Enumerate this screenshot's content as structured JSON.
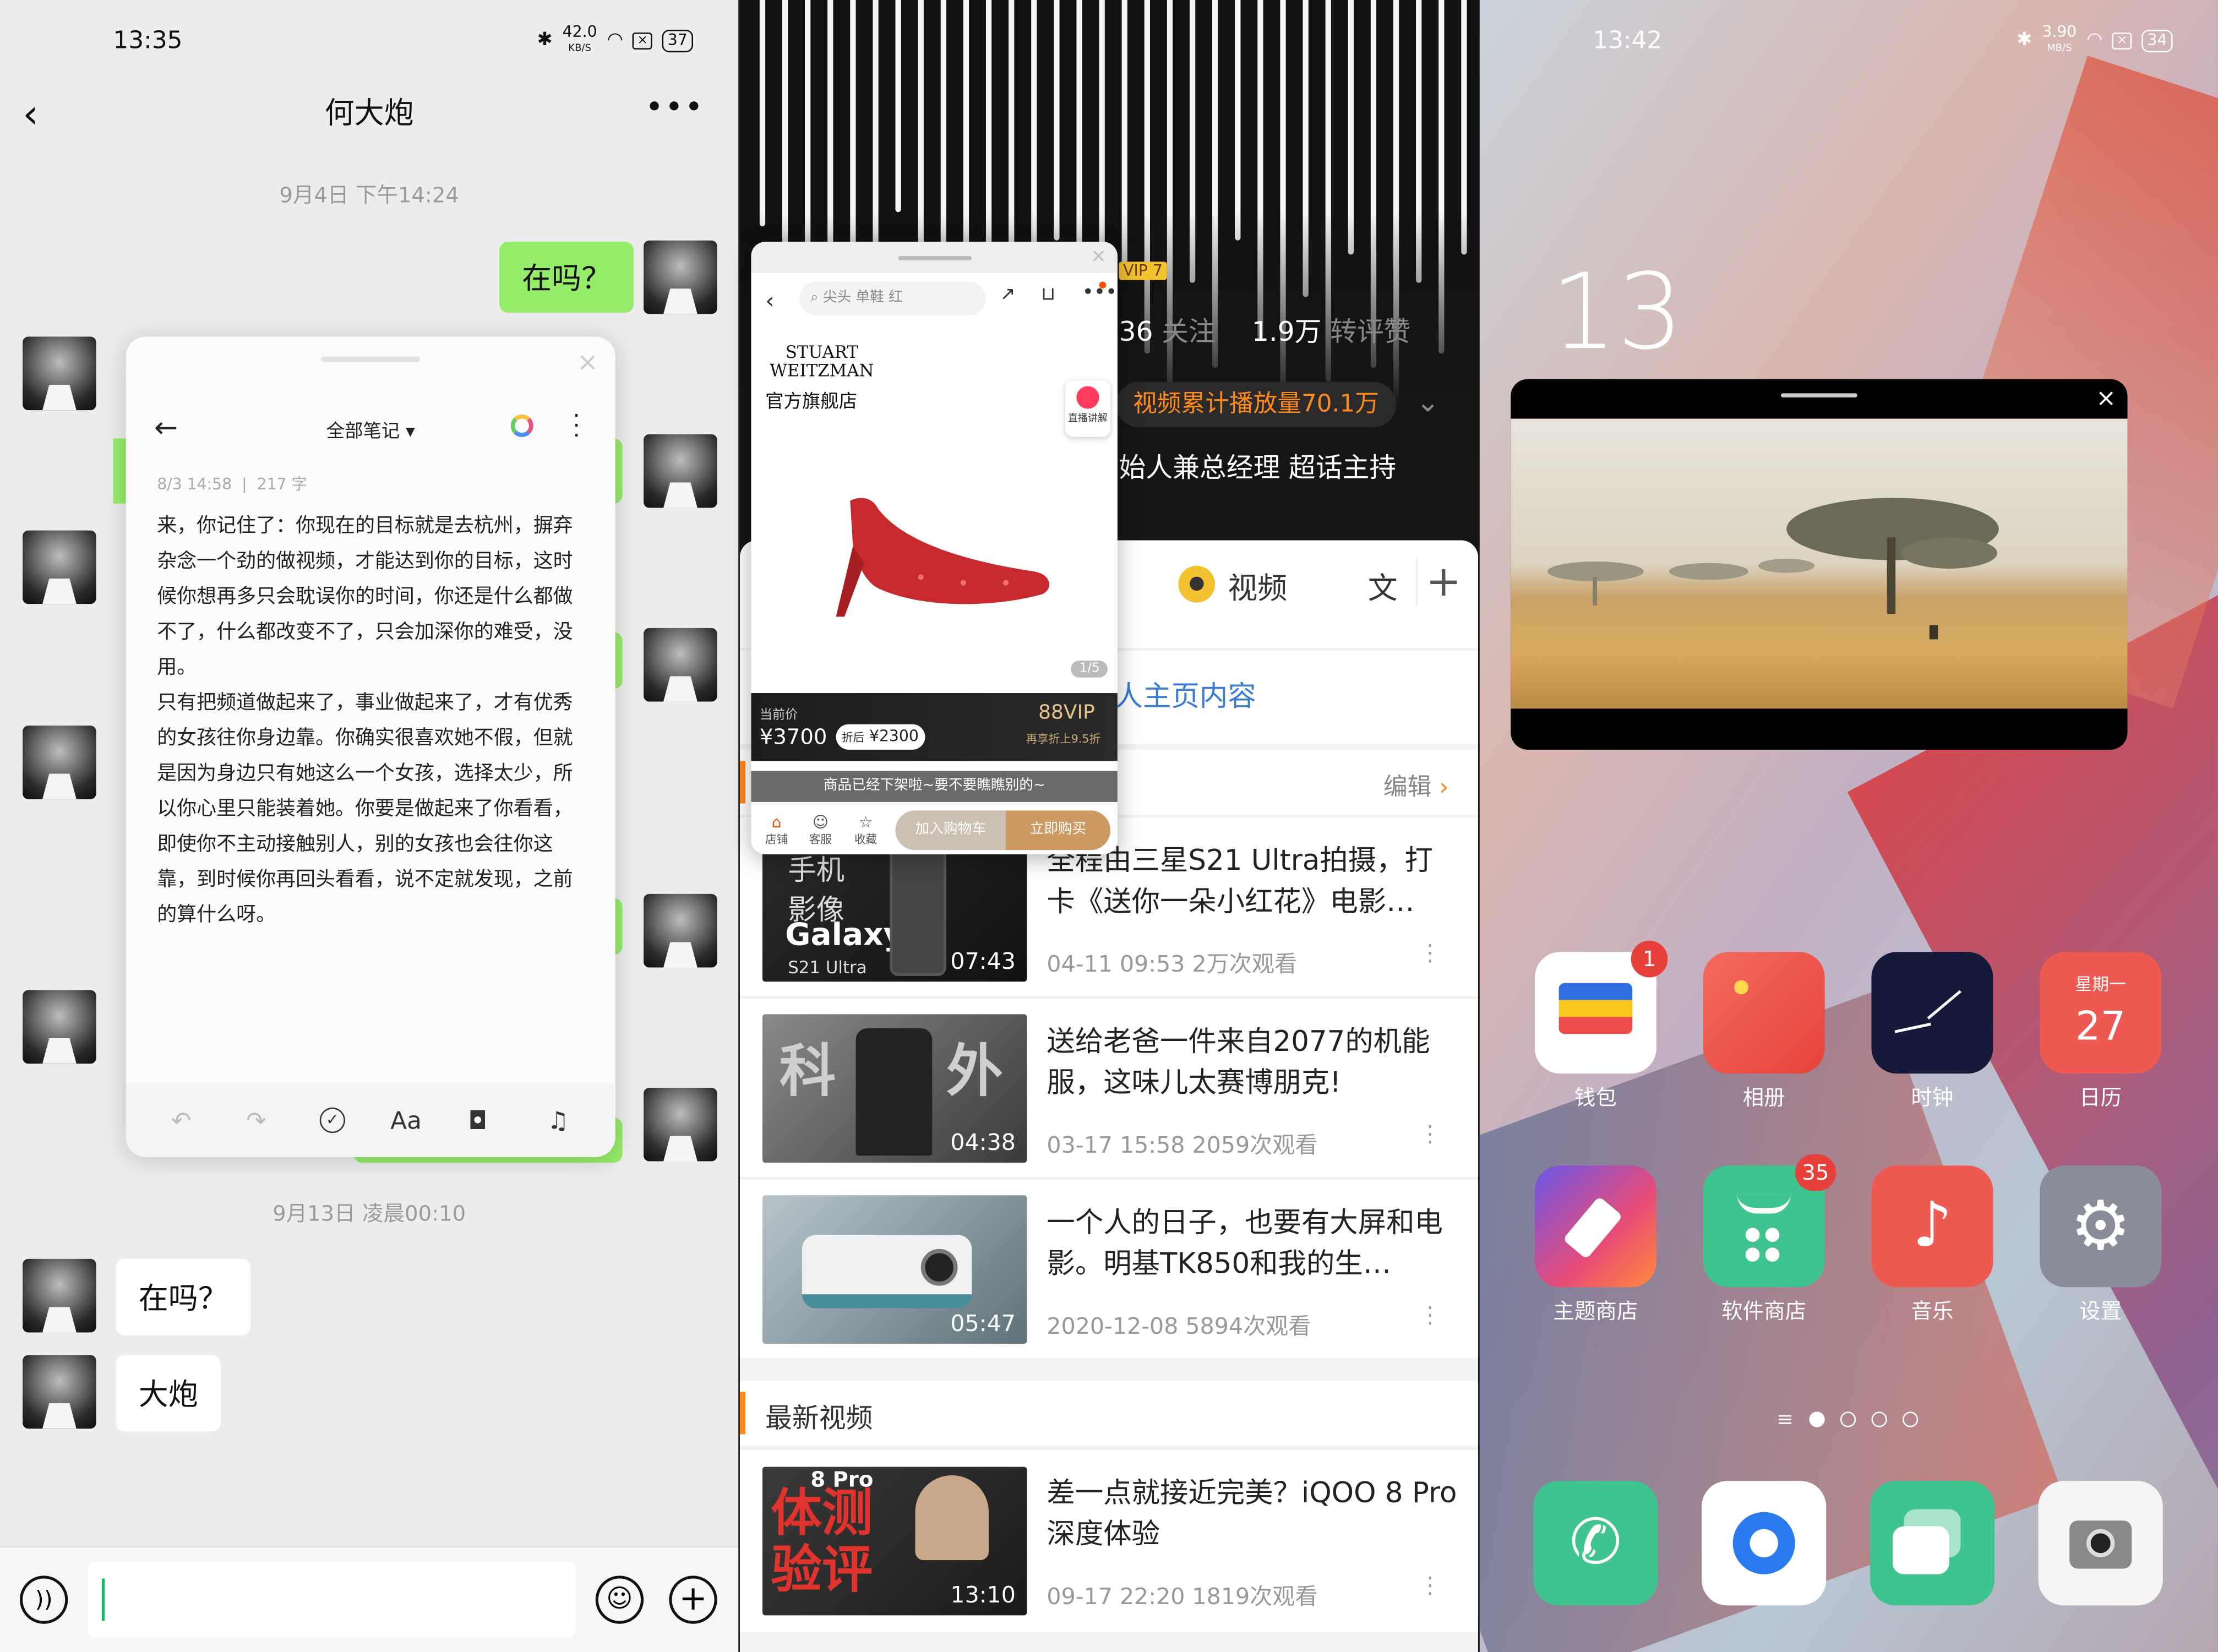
{
  "chat": {
    "status": {
      "time": "13:35",
      "speed": "42.0",
      "speed_unit": "KB/S",
      "battery": "37"
    },
    "title": "何大炮",
    "back_icon": "chevron-left-icon",
    "more_icon": "more-horizontal-icon",
    "timestamp1": "9月4日 下午14:24",
    "msg_sent": "在吗？",
    "timestamp2": "9月13日 凌晨00:10",
    "msg_recv1": "在吗？",
    "msg_recv2": "大炮",
    "input_placeholder": "",
    "voice_icon": "voice-icon",
    "emoji_icon": "emoji-icon",
    "plus_icon": "plus-icon",
    "colors": {
      "sent_bubble": "#95ec69",
      "bg": "#ededed"
    }
  },
  "note": {
    "header": "全部笔记",
    "meta_date": "8/3 14:58",
    "meta_count": "217 字",
    "body": "来，你记住了：你现在的目标就是去杭州，摒弃杂念一个劲的做视频，才能达到你的目标，这时候你想再多只会耽误你的时间，你还是什么都做不了，什么都改变不了，只会加深你的难受，没用。\n只有把频道做起来了，事业做起来了，才有优秀的女孩往你身边靠。你确实很喜欢她不假，但就是因为身边只有她这么一个女孩，选择太少，所以你心里只能装着她。你要是做起来了你看看，即使你不主动接触别人，别的女孩也会往你这靠，到时候你再回头看看，说不定就发现，之前的算什么呀。",
    "toolbar_font": "Aa"
  },
  "profile": {
    "follow_count": "36",
    "follow_label": "关注",
    "likes_count": "1.9万",
    "likes_label": "转评赞",
    "vip": "VIP 7",
    "play_count": "视频累计播放量70.1万",
    "bio": "始人兼总经理 超话主持",
    "tab_video": "视频",
    "tab_article": "文",
    "home_content": "人主页内容",
    "edit": "编辑",
    "latest": "最新视频",
    "videos": [
      {
        "thumb_text1": "手机",
        "thumb_text2": "影像",
        "thumb_text3": "Galaxy",
        "thumb_text4": "S21 Ultra",
        "duration": "07:43",
        "title": "全程由三星S21 Ultra拍摄，打卡《送你一朵小红花》电影…",
        "meta": "04-11 09:53 2万次观看"
      },
      {
        "thumb_text1": "科",
        "thumb_text2": "外",
        "duration": "04:38",
        "title": "送给老爸一件来自2077的机能服，这味儿太赛博朋克!",
        "meta": "03-17 15:58 2059次观看"
      },
      {
        "duration": "05:47",
        "title": "一个人的日子，也要有大屏和电影。明基TK850和我的生…",
        "meta": "2020-12-08 5894次观看"
      },
      {
        "thumb_text1": "8 Pro",
        "thumb_text2": "体测",
        "thumb_text3": "验评",
        "duration": "13:10",
        "title": "差一点就接近完美？iQOO 8 Pro 深度体验",
        "meta": "09-17 22:20 1819次观看"
      }
    ]
  },
  "shop": {
    "search_placeholder": "尖头 单鞋 红",
    "brand_line1": "STUART",
    "brand_line2": "WEITZMAN",
    "store_name": "官方旗舰店",
    "live_label": "直播讲解",
    "page": "1/5",
    "price_label": "当前价",
    "price": "¥3700",
    "discount_tag": "折后",
    "discount_price": "¥2300",
    "vip_label": "88VIP",
    "vip_sub": "再享折上9.5折",
    "notice": "商品已经下架啦~要不要瞧瞧别的~",
    "tab_store": "店铺",
    "tab_service": "客服",
    "tab_fav": "收藏",
    "add_cart": "加入购物车",
    "buy_now": "立即购买"
  },
  "home": {
    "status": {
      "time": "13:42",
      "speed": "3.90",
      "speed_unit": "MB/S",
      "battery": "34"
    },
    "clock_big": "13",
    "apps": [
      {
        "label": "钱包",
        "badge": "1",
        "icon": "wallet-icon"
      },
      {
        "label": "相册",
        "icon": "gallery-icon"
      },
      {
        "label": "时钟",
        "icon": "clock-icon"
      },
      {
        "label": "日历",
        "icon": "calendar-icon",
        "weekday": "星期一",
        "day": "27"
      },
      {
        "label": "主题商店",
        "icon": "theme-store-icon"
      },
      {
        "label": "软件商店",
        "badge": "35",
        "icon": "app-store-icon"
      },
      {
        "label": "音乐",
        "icon": "music-icon"
      },
      {
        "label": "设置",
        "icon": "settings-icon"
      }
    ],
    "dock": [
      "phone-icon",
      "browser-icon",
      "messages-icon",
      "camera-icon"
    ]
  }
}
